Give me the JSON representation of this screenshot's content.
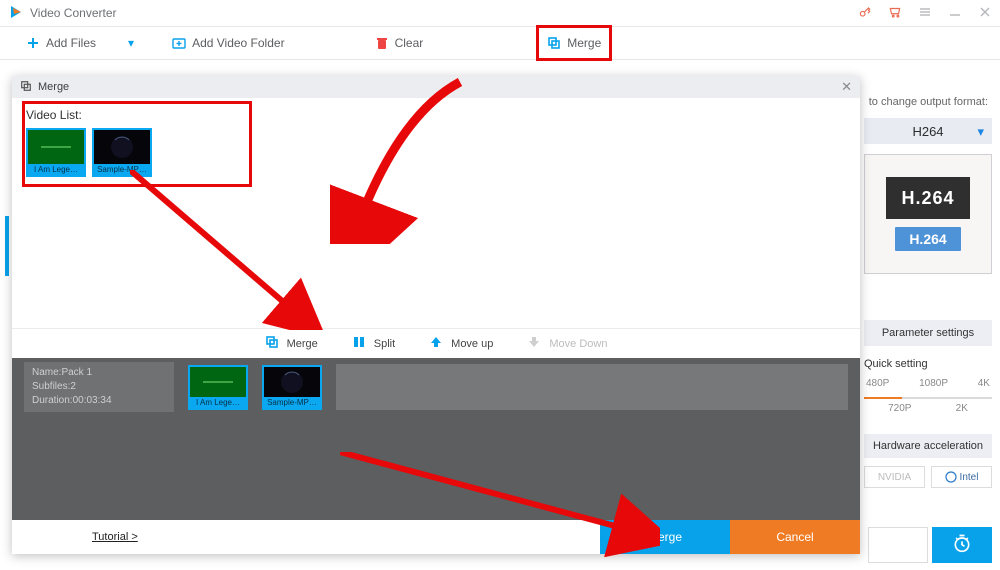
{
  "app": {
    "title": "Video Converter"
  },
  "toolbar": {
    "add_files": "Add Files",
    "add_folder": "Add Video Folder",
    "clear": "Clear",
    "merge": "Merge"
  },
  "right": {
    "change_label": "to change output format:",
    "format": "H264",
    "codec_dark": "H.264",
    "codec_pill": "H.264",
    "param_settings": "Parameter settings",
    "quick_setting": "Quick setting",
    "res": [
      "480P",
      "1080P",
      "4K",
      "720P",
      "2K"
    ],
    "accel": "Hardware acceleration",
    "vendors": [
      "NVIDIA",
      "Intel"
    ]
  },
  "modal": {
    "title": "Merge",
    "video_list_label": "Video List:",
    "thumbs": [
      {
        "caption": "I Am Lege…"
      },
      {
        "caption": "Sample-MP…"
      }
    ],
    "actions": {
      "merge": "Merge",
      "split": "Split",
      "move_up": "Move up",
      "move_down": "Move Down"
    },
    "pack": {
      "name_label": "Name:",
      "name": "Pack 1",
      "subfiles_label": "Subfiles:",
      "subfiles": "2",
      "duration_label": "Duration:",
      "duration": "00:03:34",
      "thumbs": [
        {
          "caption": "I Am Lege…"
        },
        {
          "caption": "Sample-MP…"
        }
      ]
    },
    "footer": {
      "tutorial": "Tutorial >",
      "merge": "Merge",
      "cancel": "Cancel"
    }
  }
}
